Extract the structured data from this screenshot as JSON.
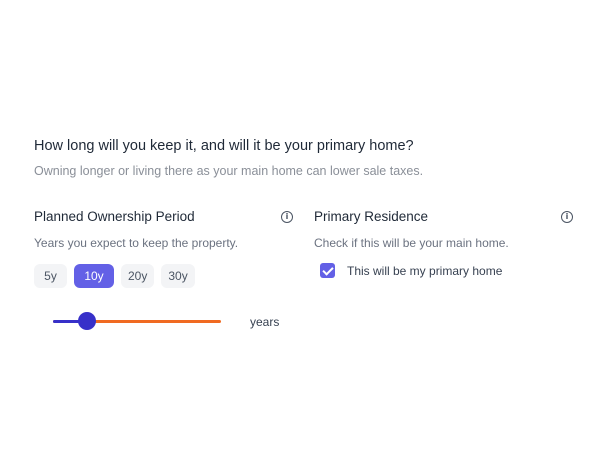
{
  "header": {
    "question": "How long will you keep it, and will it be your primary home?",
    "subtext": "Owning longer or living there as your main home can lower sale taxes."
  },
  "ownership": {
    "title": "Planned Ownership Period",
    "description": "Years you expect to keep the property.",
    "options": [
      "5y",
      "10y",
      "20y",
      "30y"
    ],
    "selected": "10y",
    "slider_fraction": 0.2,
    "unit_label": "years"
  },
  "residence": {
    "title": "Primary Residence",
    "description": "Check if this will be your main home.",
    "checkbox_label": "This will be my primary home",
    "checked": true
  },
  "icons": {
    "info": "info-icon",
    "check": "check-icon"
  },
  "colors": {
    "accent": "#6360e6",
    "slider_fill": "#3730c9",
    "slider_track": "#f06a21"
  }
}
